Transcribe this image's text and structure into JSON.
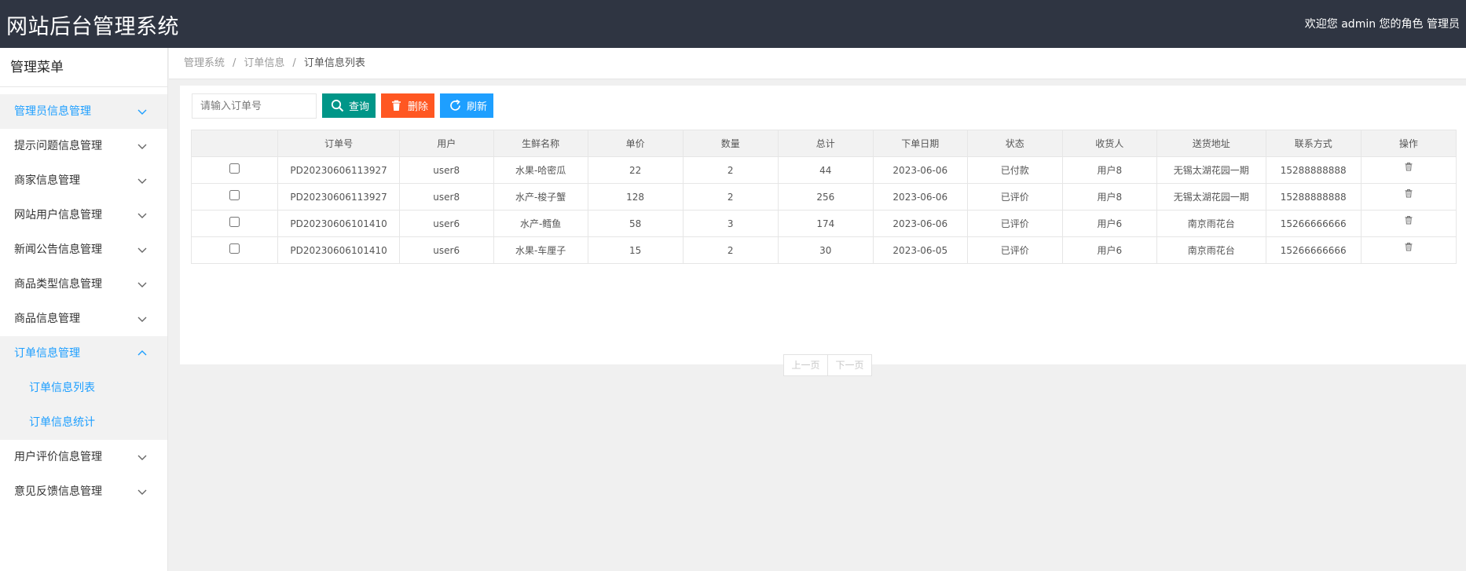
{
  "header": {
    "title": "网站后台管理系统",
    "welcome": "欢迎您 admin 您的角色 管理员"
  },
  "sidebar": {
    "title": "管理菜单",
    "items": [
      {
        "label": "管理员信息管理"
      },
      {
        "label": "提示问题信息管理"
      },
      {
        "label": "商家信息管理"
      },
      {
        "label": "网站用户信息管理"
      },
      {
        "label": "新闻公告信息管理"
      },
      {
        "label": "商品类型信息管理"
      },
      {
        "label": "商品信息管理"
      },
      {
        "label": "订单信息管理"
      },
      {
        "label": "用户评价信息管理"
      },
      {
        "label": "意见反馈信息管理"
      }
    ],
    "submenu": [
      {
        "label": "订单信息列表"
      },
      {
        "label": "订单信息统计"
      }
    ]
  },
  "breadcrumb": {
    "level1": "管理系统",
    "level2": "订单信息",
    "current": "订单信息列表",
    "separator": "/"
  },
  "toolbar": {
    "search_placeholder": "请输入订单号",
    "search_label": "查询",
    "delete_label": "删除",
    "refresh_label": "刷新"
  },
  "table": {
    "headers": [
      "订单号",
      "用户",
      "生鲜名称",
      "单价",
      "数量",
      "总计",
      "下单日期",
      "状态",
      "收货人",
      "送货地址",
      "联系方式",
      "操作"
    ],
    "rows": [
      {
        "order_no": "PD20230606113927",
        "user": "user8",
        "name": "水果-哈密瓜",
        "price": "22",
        "qty": "2",
        "total": "44",
        "date": "2023-06-06",
        "status": "已付款",
        "receiver": "用户8",
        "address": "无锡太湖花园一期",
        "phone": "15288888888"
      },
      {
        "order_no": "PD20230606113927",
        "user": "user8",
        "name": "水产-梭子蟹",
        "price": "128",
        "qty": "2",
        "total": "256",
        "date": "2023-06-06",
        "status": "已评价",
        "receiver": "用户8",
        "address": "无锡太湖花园一期",
        "phone": "15288888888"
      },
      {
        "order_no": "PD20230606101410",
        "user": "user6",
        "name": "水产-鳕鱼",
        "price": "58",
        "qty": "3",
        "total": "174",
        "date": "2023-06-06",
        "status": "已评价",
        "receiver": "用户6",
        "address": "南京雨花台",
        "phone": "15266666666"
      },
      {
        "order_no": "PD20230606101410",
        "user": "user6",
        "name": "水果-车厘子",
        "price": "15",
        "qty": "2",
        "total": "30",
        "date": "2023-06-05",
        "status": "已评价",
        "receiver": "用户6",
        "address": "南京雨花台",
        "phone": "15266666666"
      }
    ]
  },
  "pager": {
    "prev_label": "上一页",
    "next_label": "下一页"
  },
  "colors": {
    "header_bg": "#2f3542",
    "accent": "#1e9fff",
    "search_btn": "#009688",
    "delete_btn": "#ff5722",
    "refresh_btn": "#1e9fff"
  },
  "icons": {
    "search": "search-icon",
    "delete": "trash-icon",
    "refresh": "refresh-icon",
    "row_action": "trash-icon",
    "menu_collapsed": "chevron-down-icon",
    "menu_expanded": "chevron-up-icon"
  }
}
